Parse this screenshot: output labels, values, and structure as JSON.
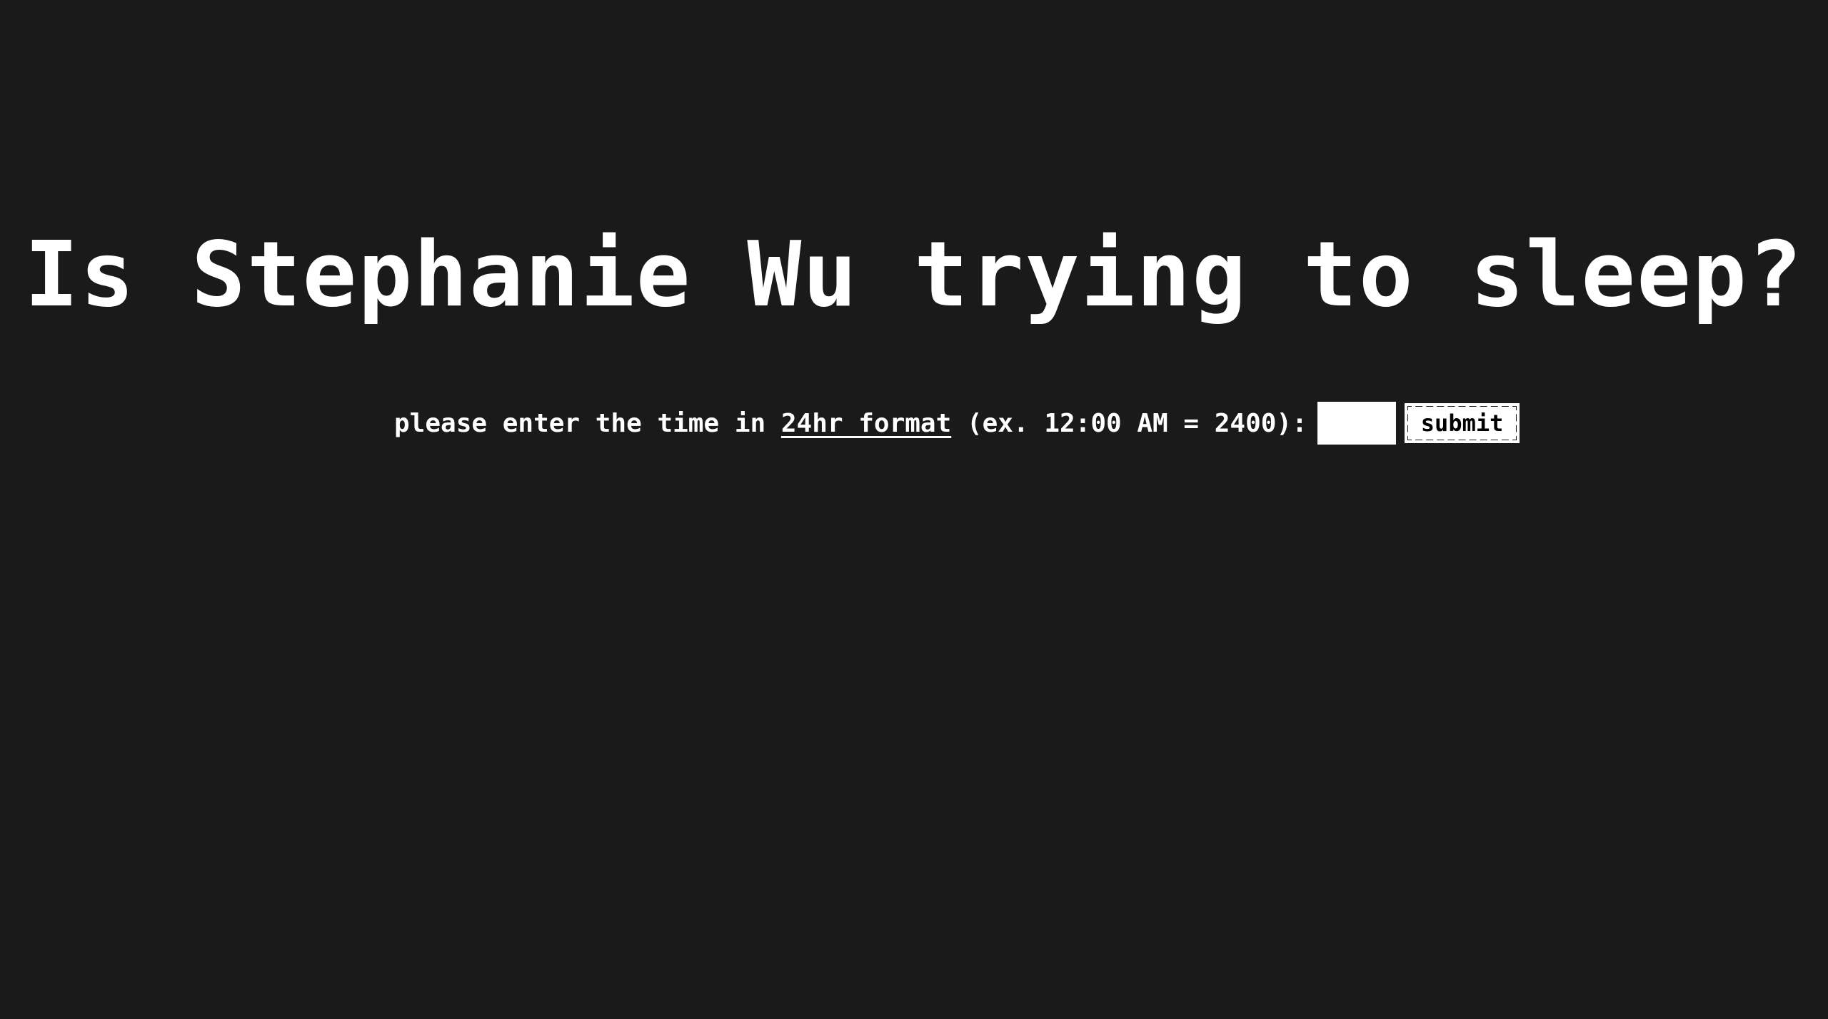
{
  "heading": {
    "title": "Is Stephanie Wu trying to sleep?"
  },
  "form": {
    "prompt_before": "please enter the time in ",
    "link_text": "24hr format",
    "prompt_after": " (ex. 12:00 AM = 2400):",
    "input_value": "",
    "submit_label": "submit"
  },
  "colors": {
    "background": "#1a1a1a",
    "text": "#ffffff",
    "input_background": "#ffffff"
  }
}
